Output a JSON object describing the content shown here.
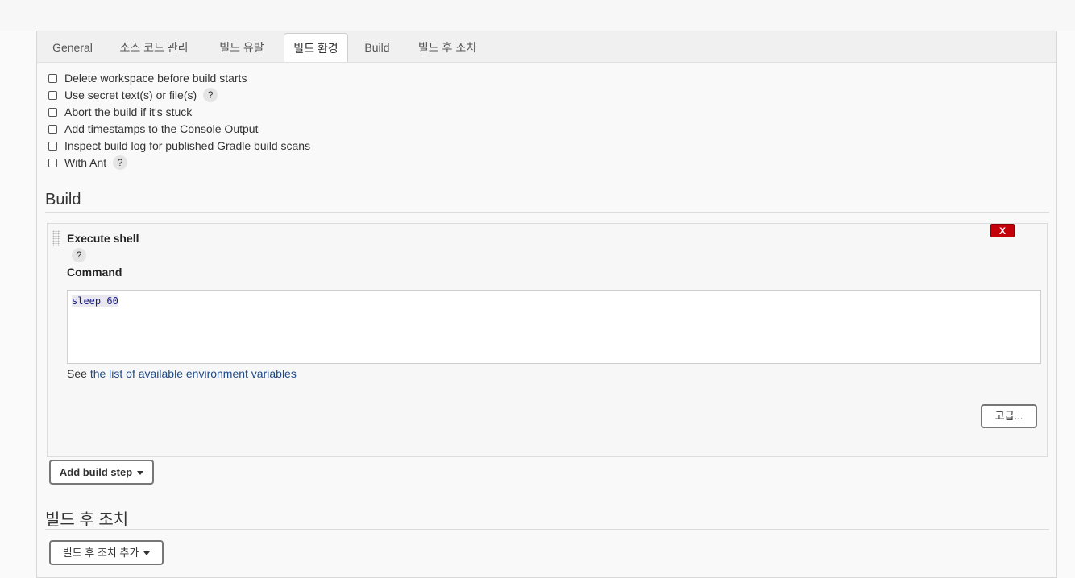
{
  "tabs": [
    {
      "label": "General"
    },
    {
      "label": "소스 코드 관리"
    },
    {
      "label": "빌드 유발"
    },
    {
      "label": "빌드 환경"
    },
    {
      "label": "Build"
    },
    {
      "label": "빌드 후 조치"
    }
  ],
  "active_tab": "빌드 환경",
  "build_env_options": [
    {
      "label": "Delete workspace before build starts",
      "checked": false,
      "help": ""
    },
    {
      "label": "Use secret text(s) or file(s)",
      "checked": false,
      "help": "?"
    },
    {
      "label": "Abort the build if it's stuck",
      "checked": false,
      "help": ""
    },
    {
      "label": "Add timestamps to the Console Output",
      "checked": false,
      "help": ""
    },
    {
      "label": "Inspect build log for published Gradle build scans",
      "checked": false,
      "help": ""
    },
    {
      "label": "With Ant",
      "checked": false,
      "help": "?"
    }
  ],
  "build_section": {
    "title": "Build",
    "step": {
      "title": "Execute shell",
      "delete_label": "X",
      "help": "?",
      "command_label": "Command",
      "command_value": "sleep 60",
      "env_prefix": "See",
      "env_link": "the list of available environment variables",
      "advanced_label": "고급..."
    },
    "add_step_label": "Add build step"
  },
  "post_build_section": {
    "title": "빌드 후 조치",
    "add_action_label": "빌드 후 조치 추가"
  },
  "colors": {
    "delete_button": "#c4000a",
    "link": "#204a87"
  }
}
